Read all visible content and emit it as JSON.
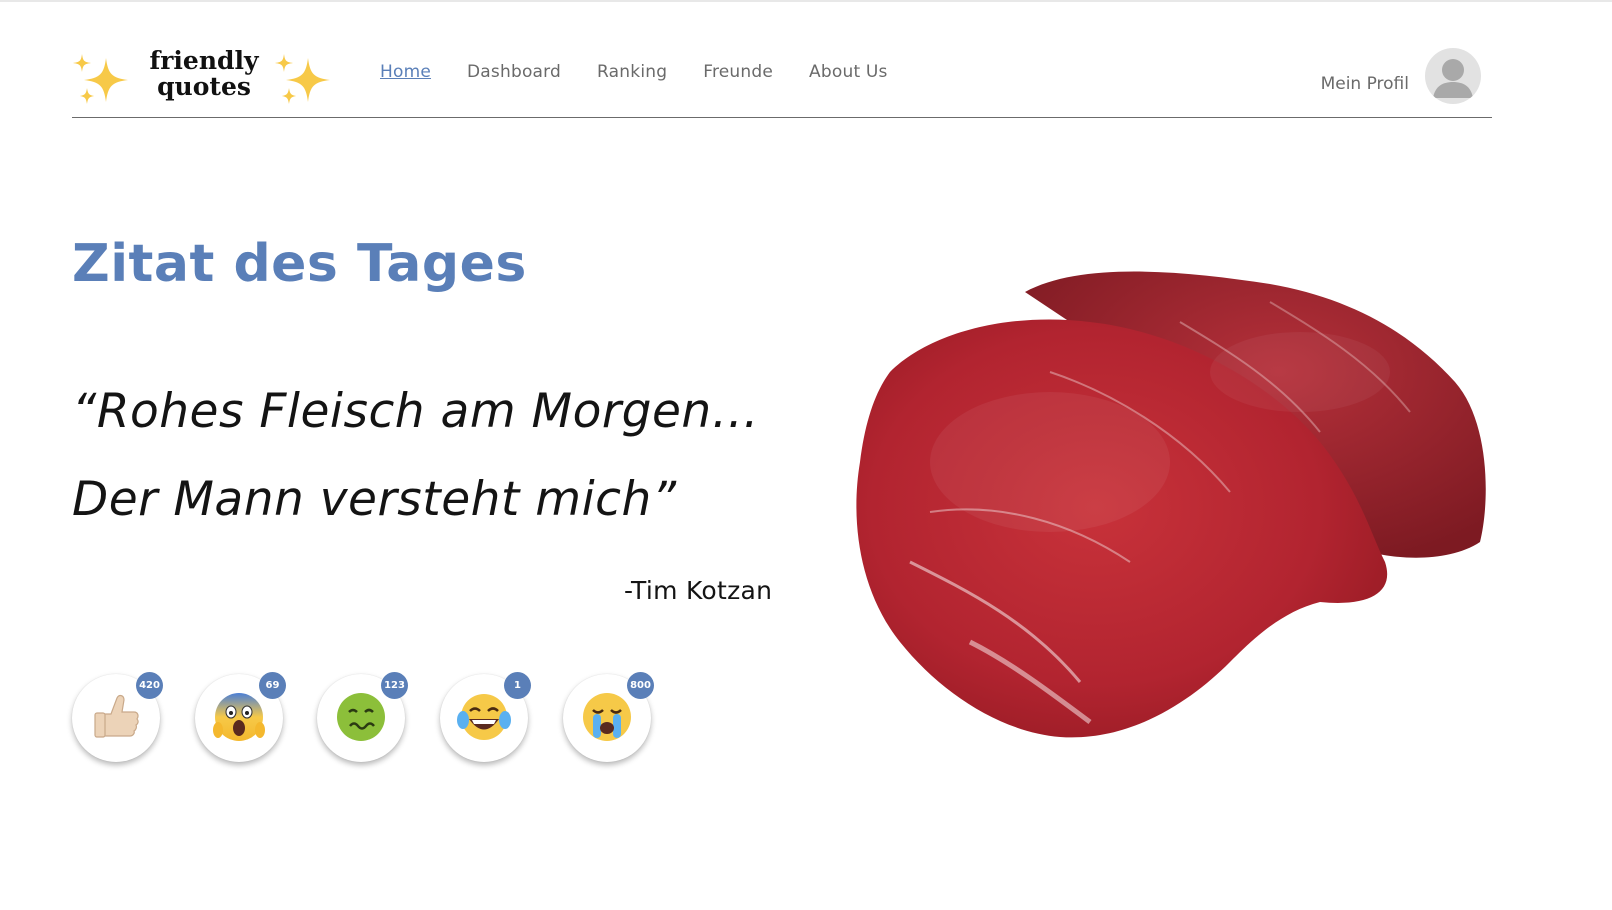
{
  "logo": {
    "text_line1": "friendly",
    "text_line2": "quotes",
    "sparkle_icon": "sparkles-icon"
  },
  "nav": {
    "items": [
      {
        "label": "Home",
        "active": true
      },
      {
        "label": "Dashboard",
        "active": false
      },
      {
        "label": "Ranking",
        "active": false
      },
      {
        "label": "Freunde",
        "active": false
      },
      {
        "label": "About Us",
        "active": false
      }
    ]
  },
  "profile": {
    "label": "Mein Profil",
    "avatar_icon": "user-avatar-icon"
  },
  "hero": {
    "title": "Zitat des Tages",
    "quote_line1": "“Rohes Fleisch  am Morgen…",
    "quote_line2": "Der Mann versteht mich”",
    "author": "-Tim Kotzan",
    "image": "raw-steak-image"
  },
  "reactions": [
    {
      "name": "thumbs-up",
      "icon": "thumbs-up-icon",
      "count": "420"
    },
    {
      "name": "screaming-face",
      "icon": "screaming-face-icon",
      "count": "69"
    },
    {
      "name": "nauseated-face",
      "icon": "nauseated-face-icon",
      "count": "123"
    },
    {
      "name": "tears-of-joy",
      "icon": "tears-of-joy-icon",
      "count": "1"
    },
    {
      "name": "crying-face",
      "icon": "crying-face-icon",
      "count": "800"
    }
  ],
  "colors": {
    "accent": "#5a7fb8",
    "nav_text": "#6a6a6a",
    "badge": "#5a7fb8",
    "header_rule": "#6b6b6b"
  }
}
